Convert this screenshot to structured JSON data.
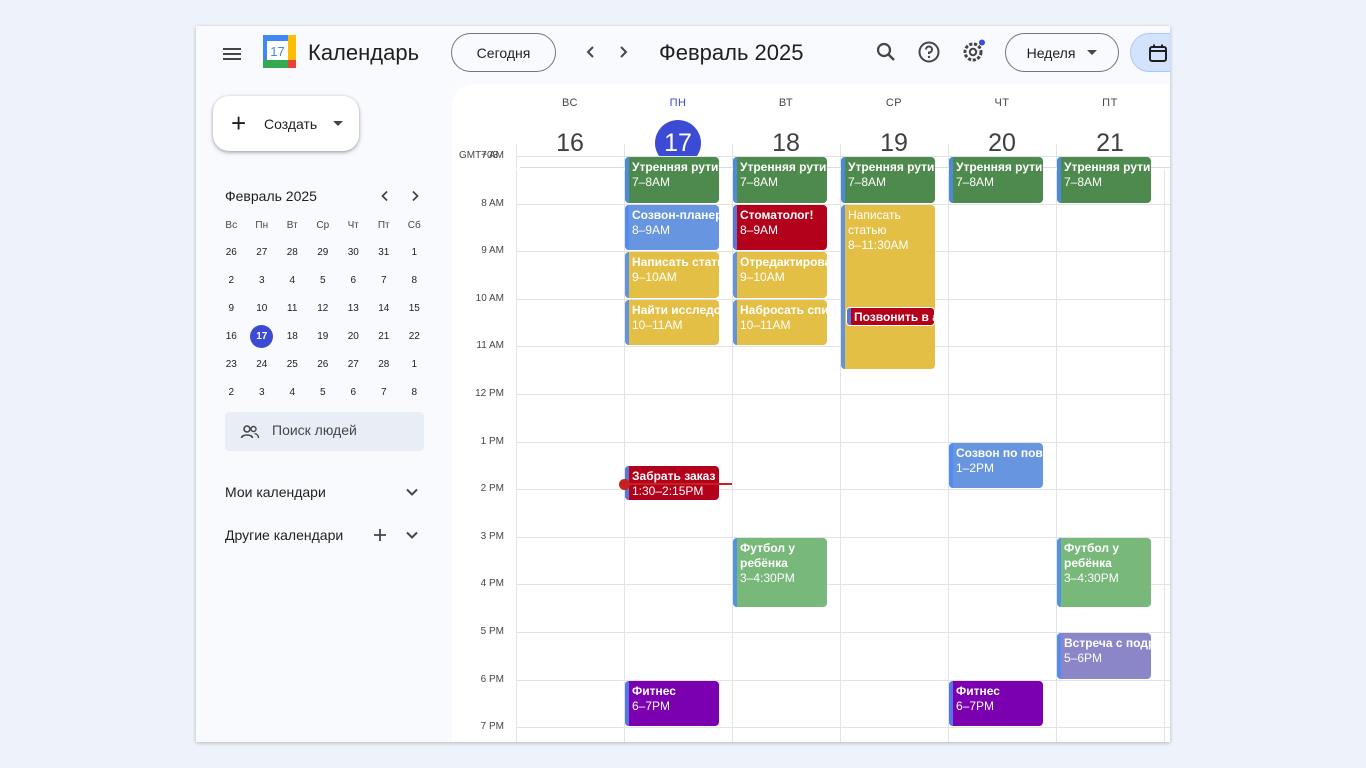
{
  "app": {
    "title": "Календарь",
    "logo_day": "17"
  },
  "toolbar": {
    "today_label": "Сегодня",
    "month_title": "Февраль 2025",
    "view_label": "Неделя"
  },
  "sidebar": {
    "create_label": "Создать",
    "mini_calendar": {
      "title": "Февраль 2025",
      "weekdays": [
        "Вс",
        "Пн",
        "Вт",
        "Ср",
        "Чт",
        "Пт",
        "Сб"
      ],
      "weeks": [
        [
          "26",
          "27",
          "28",
          "29",
          "30",
          "31",
          "1"
        ],
        [
          "2",
          "3",
          "4",
          "5",
          "6",
          "7",
          "8"
        ],
        [
          "9",
          "10",
          "11",
          "12",
          "13",
          "14",
          "15"
        ],
        [
          "16",
          "17",
          "18",
          "19",
          "20",
          "21",
          "22"
        ],
        [
          "23",
          "24",
          "25",
          "26",
          "27",
          "28",
          "1"
        ],
        [
          "2",
          "3",
          "4",
          "5",
          "6",
          "7",
          "8"
        ]
      ],
      "selected": "17"
    },
    "people_search_placeholder": "Поиск людей",
    "my_calendars_label": "Мои календари",
    "other_calendars_label": "Другие календари"
  },
  "week": {
    "timezone": "GMT+03",
    "days": [
      {
        "dow": "ВС",
        "num": "16",
        "today": false
      },
      {
        "dow": "ПН",
        "num": "17",
        "today": true
      },
      {
        "dow": "ВТ",
        "num": "18",
        "today": false
      },
      {
        "dow": "СР",
        "num": "19",
        "today": false
      },
      {
        "dow": "ЧТ",
        "num": "20",
        "today": false
      },
      {
        "dow": "ПТ",
        "num": "21",
        "today": false
      }
    ],
    "hours": [
      "7 AM",
      "8 AM",
      "9 AM",
      "10 AM",
      "11 AM",
      "12 PM",
      "1 PM",
      "2 PM",
      "3 PM",
      "4 PM",
      "5 PM",
      "6 PM",
      "7 PM"
    ],
    "now_time": "1:53 PM",
    "events": [
      {
        "day": 1,
        "title": "Утренняя рутина",
        "time": "7–8AM",
        "color": "#4e8a4d"
      },
      {
        "day": 2,
        "title": "Утренняя рутина",
        "time": "7–8AM",
        "color": "#4e8a4d"
      },
      {
        "day": 3,
        "title": "Утренняя рутина",
        "time": "7–8AM",
        "color": "#4e8a4d"
      },
      {
        "day": 4,
        "title": "Утренняя рутина",
        "time": "7–8AM",
        "color": "#4e8a4d"
      },
      {
        "day": 5,
        "title": "Утренняя рутина",
        "time": "7–8AM",
        "color": "#4e8a4d"
      },
      {
        "day": 1,
        "title": "Созвон-планерка",
        "time": "8–9AM",
        "color": "#6795e0"
      },
      {
        "day": 2,
        "title": "Стоматолог!",
        "time": "8–9AM",
        "color": "#b3001b"
      },
      {
        "day": 3,
        "title": "Написать статью",
        "time": "8–11:30AM",
        "color": "#e3bf45"
      },
      {
        "day": 1,
        "title": "Написать статью",
        "time": "9–10AM",
        "color": "#e3bf45"
      },
      {
        "day": 2,
        "title": "Отредактировать",
        "time": "9–10AM",
        "color": "#e3bf45"
      },
      {
        "day": 1,
        "title": "Найти исследование",
        "time": "10–11AM",
        "color": "#e3bf45"
      },
      {
        "day": 2,
        "title": "Набросать список",
        "time": "10–11AM",
        "color": "#e3bf45"
      },
      {
        "day": 3,
        "title": "Позвонить в а",
        "time": "",
        "color": "#b3001b"
      },
      {
        "day": 4,
        "title": "Созвон по поводу",
        "time": "1–2PM",
        "color": "#6795e0"
      },
      {
        "day": 1,
        "title": "Забрать заказ",
        "time": "1:30–2:15PM",
        "color": "#b3001b"
      },
      {
        "day": 2,
        "title": "Футбол у ребёнка",
        "time": "3–4:30PM",
        "color": "#78b87a"
      },
      {
        "day": 5,
        "title": "Футбол у ребёнка",
        "time": "3–4:30PM",
        "color": "#78b87a"
      },
      {
        "day": 5,
        "title": "Встреча с подругой",
        "time": "5–6PM",
        "color": "#8a86c8"
      },
      {
        "day": 1,
        "title": "Фитнес",
        "time": "6–7PM",
        "color": "#7a00b0"
      },
      {
        "day": 4,
        "title": "Фитнес",
        "time": "6–7PM",
        "color": "#7a00b0"
      }
    ]
  },
  "icons": {
    "menu": "menu-icon",
    "search": "search-icon",
    "help": "help-icon",
    "settings": "settings-icon",
    "calendar_view": "calendar-icon",
    "people": "people-icon"
  }
}
